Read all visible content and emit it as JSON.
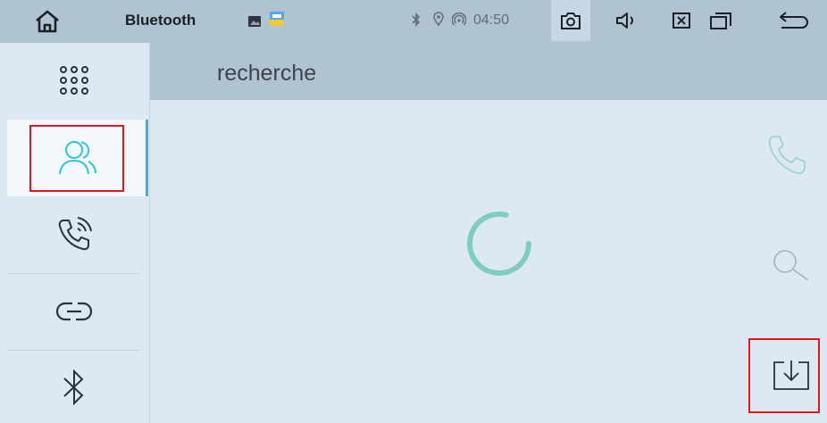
{
  "status_bar": {
    "title": "Bluetooth",
    "time": "04:50",
    "icons": [
      "home-icon",
      "gallery-icon",
      "hd-radio-icon",
      "bluetooth-icon",
      "location-icon",
      "hotspot-icon",
      "camera-icon",
      "volume-icon",
      "close-app-icon",
      "recent-apps-icon",
      "back-icon"
    ]
  },
  "sidebar": {
    "items": [
      {
        "name": "apps-grid",
        "icon": "grid-icon"
      },
      {
        "name": "contacts",
        "icon": "contacts-icon",
        "active": true
      },
      {
        "name": "call-log",
        "icon": "call-log-icon"
      },
      {
        "name": "pairing",
        "icon": "link-icon"
      },
      {
        "name": "bluetooth-settings",
        "icon": "bluetooth-icon"
      }
    ]
  },
  "main": {
    "title": "recherche"
  },
  "actions": [
    {
      "name": "call",
      "icon": "phone-icon"
    },
    {
      "name": "search",
      "icon": "search-icon"
    },
    {
      "name": "download",
      "icon": "download-icon"
    }
  ],
  "colors": {
    "bar": "#b0c3d1",
    "background": "#dce9f4",
    "accent": "#2fc6d8",
    "spinner": "#7fcdbf",
    "highlight": "#e5161b"
  }
}
